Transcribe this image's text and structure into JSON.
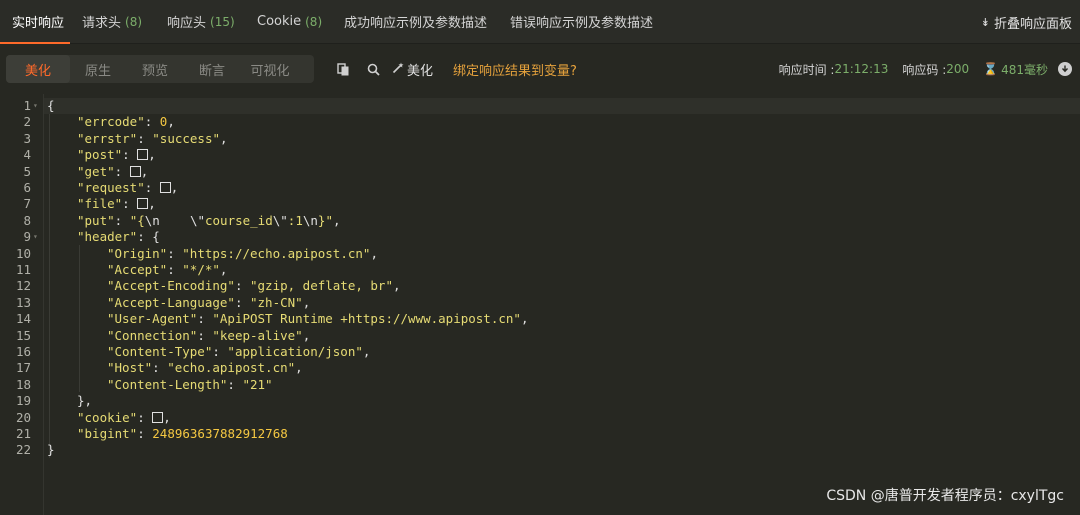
{
  "tabs": [
    {
      "label": "实时响应",
      "count": ""
    },
    {
      "label": "请求头",
      "count": "(8)"
    },
    {
      "label": "响应头",
      "count": "(15)"
    },
    {
      "label": "Cookie",
      "count": "(8)"
    },
    {
      "label": "成功响应示例及参数描述",
      "count": ""
    },
    {
      "label": "错误响应示例及参数描述",
      "count": ""
    }
  ],
  "collapse_label": "折叠响应面板",
  "view_modes": [
    "美化",
    "原生",
    "预览",
    "断言",
    "可视化"
  ],
  "toolbar": {
    "beautify_label": "美化",
    "bind_label": "绑定响应结果到变量?"
  },
  "meta": {
    "time_label": "响应时间 : ",
    "time_value": "21:12:13",
    "code_label": "响应码 : ",
    "code_value": "200",
    "duration_value": "481毫秒"
  },
  "code_lines": [
    "{",
    "\"errcode\": 0,",
    "\"errstr\": \"success\",",
    "\"post\": [],",
    "\"get\": [],",
    "\"request\": [],",
    "\"file\": [],",
    "\"put\": \"{\\n    \\\"course_id\\\":1\\n}\",",
    "\"header\": {",
    "\"Origin\": \"https://echo.apipost.cn\",",
    "\"Accept\": \"*/*\",",
    "\"Accept-Encoding\": \"gzip, deflate, br\",",
    "\"Accept-Language\": \"zh-CN\",",
    "\"User-Agent\": \"ApiPOST Runtime +https://www.apipost.cn\",",
    "\"Connection\": \"keep-alive\",",
    "\"Content-Type\": \"application/json\",",
    "\"Host\": \"echo.apipost.cn\",",
    "\"Content-Length\": \"21\"",
    "},",
    "\"cookie\": [],",
    "\"bigint\": 248963637882912768",
    "}"
  ],
  "watermark": "CSDN @唐普开发者程序员：cxylTgc"
}
